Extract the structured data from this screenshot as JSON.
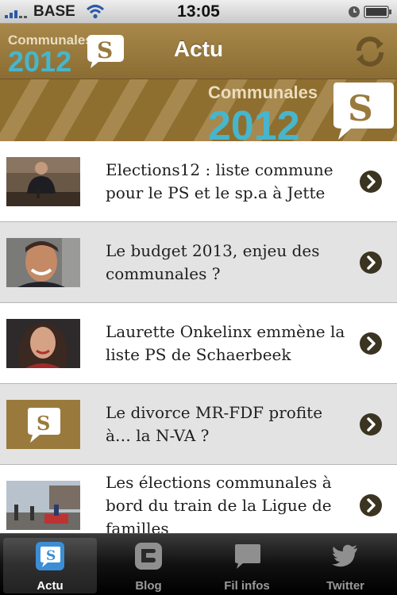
{
  "status_bar": {
    "carrier": "BASE",
    "time": "13:05"
  },
  "nav": {
    "logo_word": "Communales",
    "logo_year": "2012",
    "logo_letter": "S",
    "title": "Actu"
  },
  "banner": {
    "word": "Communales",
    "year": "2012",
    "letter": "S"
  },
  "articles": [
    {
      "title": "Elections12 : liste commune pour le PS et le sp.a à Jette"
    },
    {
      "title": "Le budget 2013, enjeu des communales ?"
    },
    {
      "title": "Laurette Onkelinx emmène la liste PS de Schaerbeek"
    },
    {
      "title": "Le divorce MR-FDF profite à… la N-VA ?",
      "thumb_letter": "S"
    },
    {
      "title": "Les élections communales à bord du train de la Ligue de familles"
    }
  ],
  "tabs": [
    {
      "label": "Actu",
      "icon": "s-logo-icon",
      "active": true
    },
    {
      "label": "Blog",
      "icon": "blogger-icon",
      "active": false
    },
    {
      "label": "Fil infos",
      "icon": "speech-bubble-icon",
      "active": false
    },
    {
      "label": "Twitter",
      "icon": "twitter-bird-icon",
      "active": false
    }
  ],
  "colors": {
    "brand_gold": "#9a7a3c",
    "brand_teal": "#3fb0c8",
    "tab_bar": "#111111"
  }
}
